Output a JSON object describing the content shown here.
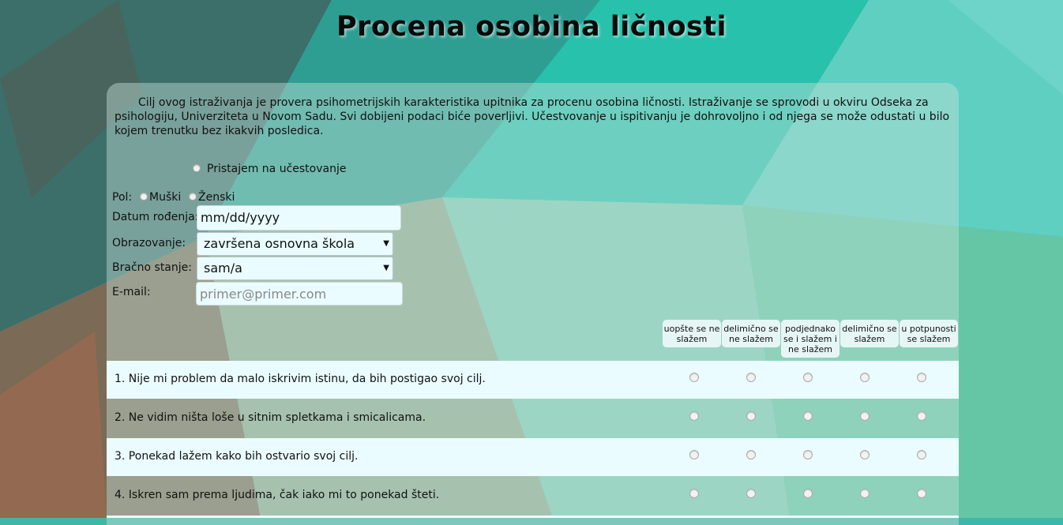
{
  "page": {
    "title": "Procena osobina ličnosti",
    "intro": "Cilj ovog istraživanja je provera psihometrijskih karakteristika upitnika za procenu osobina ličnosti. Istraživanje se sprovodi u okviru Odseka za psihologiju, Univerziteta u Novom Sadu. Svi dobijeni podaci biće poverljivi. Učestvovanje u ispitivanju je dohrovoljno i od njega se može odustati u bilo kojem trenutku bez ikakvih posledica."
  },
  "consent": {
    "label": "Pristajem na učestovanje"
  },
  "form": {
    "gender_label": "Pol:",
    "gender_options": [
      "Muški",
      "Ženski"
    ],
    "dob_label": "Datum rođenja:",
    "dob_value": "mm/dd/yyyy",
    "education_label": "Obrazovanje:",
    "education_value": "završena osnovna škola",
    "marital_label": "Bračno stanje:",
    "marital_value": "sam/a",
    "email_label": "E-mail:",
    "email_placeholder": "primer@primer.com"
  },
  "scale": [
    "uopšte se ne slažem",
    "delimično se ne slažem",
    "podjednako se i slažem i ne slažem",
    "delimično se slažem",
    "u potpunosti se slažem"
  ],
  "questions": [
    "1. Nije mi problem da malo iskrivim istinu, da bih postigao svoj cilj.",
    "2. Ne vidim ništa loše u sitnim spletkama i smicalicama.",
    "3. Ponekad lažem kako bih ostvario svoj cilj.",
    "4. Iskren sam prema ljudima, čak iako mi to ponekad šteti."
  ],
  "colors": {
    "accent": "#3fb7a6",
    "row_light": "#eafcff"
  }
}
